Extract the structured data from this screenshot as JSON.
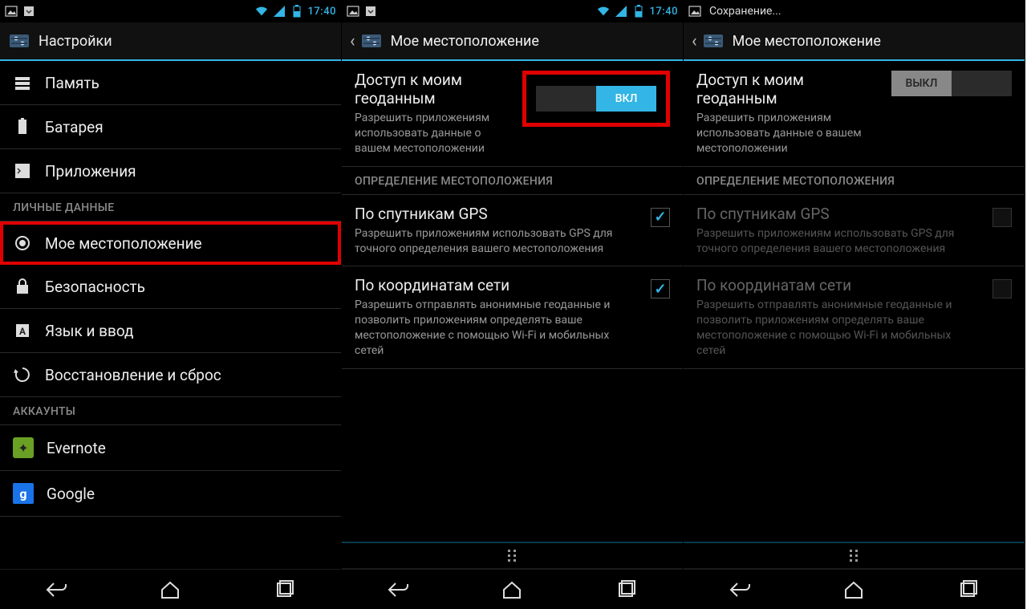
{
  "statusbar": {
    "time": "17:40",
    "saving": "Сохранение..."
  },
  "screen1": {
    "header_title": "Настройки",
    "items": {
      "memory": "Память",
      "battery": "Батарея",
      "apps": "Приложения",
      "location": "Мое местоположение",
      "security": "Безопасность",
      "language": "Язык и ввод",
      "backup": "Восстановление и сброс",
      "evernote": "Evernote",
      "google": "Google"
    },
    "sections": {
      "personal": "ЛИЧНЫЕ ДАННЫЕ",
      "accounts": "АККАУНТЫ"
    }
  },
  "screen2": {
    "header_title": "Мое местоположение",
    "access": {
      "title": "Доступ к моим геоданным",
      "sub": "Разрешить приложениям использовать данные о вашем местоположении",
      "toggle": "ВКЛ"
    },
    "section_label": "ОПРЕДЕЛЕНИЕ МЕСТОПОЛОЖЕНИЯ",
    "gps": {
      "title": "По спутникам GPS",
      "sub": "Разрешить приложениям использовать GPS для точного определения вашего местоположения"
    },
    "net": {
      "title": "По координатам сети",
      "sub": "Разрешить отправлять анонимные геоданные и позволить приложениям определять ваше местоположение с помощью Wi-Fi и мобильных сетей"
    }
  },
  "screen3": {
    "header_title": "Мое местоположение",
    "access": {
      "title": "Доступ к моим геоданным",
      "sub": "Разрешить приложениям использовать данные о вашем местоположении",
      "toggle": "ВЫКЛ"
    },
    "section_label": "ОПРЕДЕЛЕНИЕ МЕСТОПОЛОЖЕНИЯ",
    "gps": {
      "title": "По спутникам GPS",
      "sub": "Разрешить приложениям использовать GPS для точного определения вашего местоположения"
    },
    "net": {
      "title": "По координатам сети",
      "sub": "Разрешить отправлять анонимные геоданные и позволить приложениям определять ваше местоположение с помощью Wi-Fi и мобильных сетей"
    }
  }
}
